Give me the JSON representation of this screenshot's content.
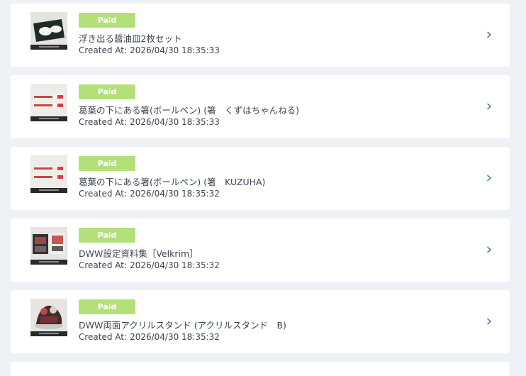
{
  "orders": [
    {
      "status": "Paid",
      "name": "浮き出る醤油皿2枚セット",
      "created_label": "Created At:",
      "created_at": "2026/04/30 18:35:33",
      "thumbnail_icon": "soy-sauce-plate-thumbnail"
    },
    {
      "status": "Paid",
      "name": "葛葉の下にある箸(ボールペン) (箸　くずはちゃんねる)",
      "created_label": "Created At:",
      "created_at": "2026/04/30 18:35:33",
      "thumbnail_icon": "chopstick-pen-thumbnail"
    },
    {
      "status": "Paid",
      "name": "葛葉の下にある箸(ボールペン) (箸　KUZUHA)",
      "created_label": "Created At:",
      "created_at": "2026/04/30 18:35:32",
      "thumbnail_icon": "chopstick-pen-thumbnail"
    },
    {
      "status": "Paid",
      "name": "DWW設定資料集［Velkrim］",
      "created_label": "Created At:",
      "created_at": "2026/04/30 18:35:32",
      "thumbnail_icon": "art-book-thumbnail"
    },
    {
      "status": "Paid",
      "name": "DWW両面アクリルスタンド (アクリルスタンド　B)",
      "created_label": "Created At:",
      "created_at": "2026/04/30 18:35:32",
      "thumbnail_icon": "acrylic-stand-thumbnail"
    }
  ],
  "colors": {
    "page_background": "#eef1f5",
    "card_background": "#ffffff",
    "paid_badge": "#b4e07a",
    "chevron": "#4f7fae",
    "text": "#3d4450"
  },
  "icons": {
    "chevron": "chevron-right-icon"
  }
}
